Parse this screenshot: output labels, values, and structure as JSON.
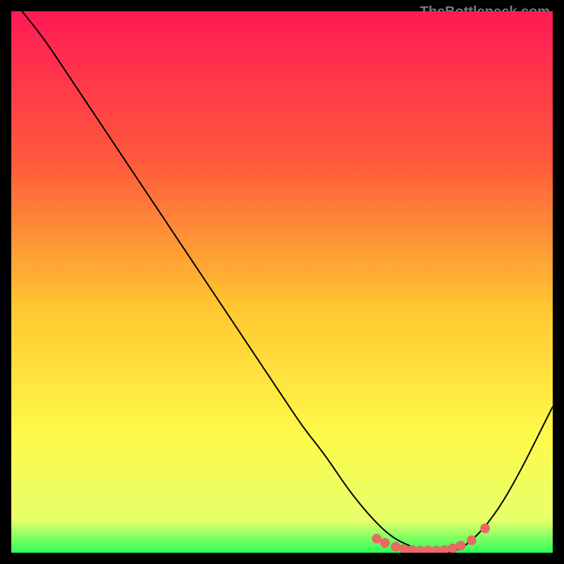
{
  "watermark": "TheBottleneck.com",
  "chart_data": {
    "type": "line",
    "title": "",
    "xlabel": "",
    "ylabel": "",
    "xlim": [
      0,
      100
    ],
    "ylim": [
      0,
      100
    ],
    "gradient_stops": [
      {
        "offset": 0,
        "color": "#ff1a55"
      },
      {
        "offset": 28,
        "color": "#ff5a3c"
      },
      {
        "offset": 55,
        "color": "#ffc830"
      },
      {
        "offset": 78,
        "color": "#fff94a"
      },
      {
        "offset": 94,
        "color": "#e7ff6a"
      },
      {
        "offset": 100,
        "color": "#2bff5c"
      }
    ],
    "series": [
      {
        "name": "bottleneck-curve",
        "color": "#000000",
        "x": [
          2,
          6,
          10,
          14,
          18,
          22,
          26,
          30,
          34,
          38,
          42,
          46,
          50,
          54,
          58,
          62,
          66,
          70,
          74,
          78,
          82,
          86,
          90,
          94,
          98,
          100
        ],
        "y": [
          100,
          95,
          89,
          83,
          77,
          71,
          65,
          59,
          53,
          47,
          41,
          35,
          29,
          23,
          18,
          12,
          7,
          3,
          1,
          0,
          0,
          3,
          8,
          15,
          23,
          27
        ]
      }
    ],
    "markers": {
      "color": "#e86a62",
      "x": [
        67.5,
        69.0,
        71.0,
        72.5,
        74.0,
        75.5,
        77.0,
        78.5,
        80.0,
        81.5,
        83.0,
        85.0,
        87.5
      ],
      "y": [
        2.6,
        1.8,
        1.1,
        0.7,
        0.5,
        0.4,
        0.4,
        0.4,
        0.5,
        0.8,
        1.3,
        2.3,
        4.5
      ]
    }
  }
}
